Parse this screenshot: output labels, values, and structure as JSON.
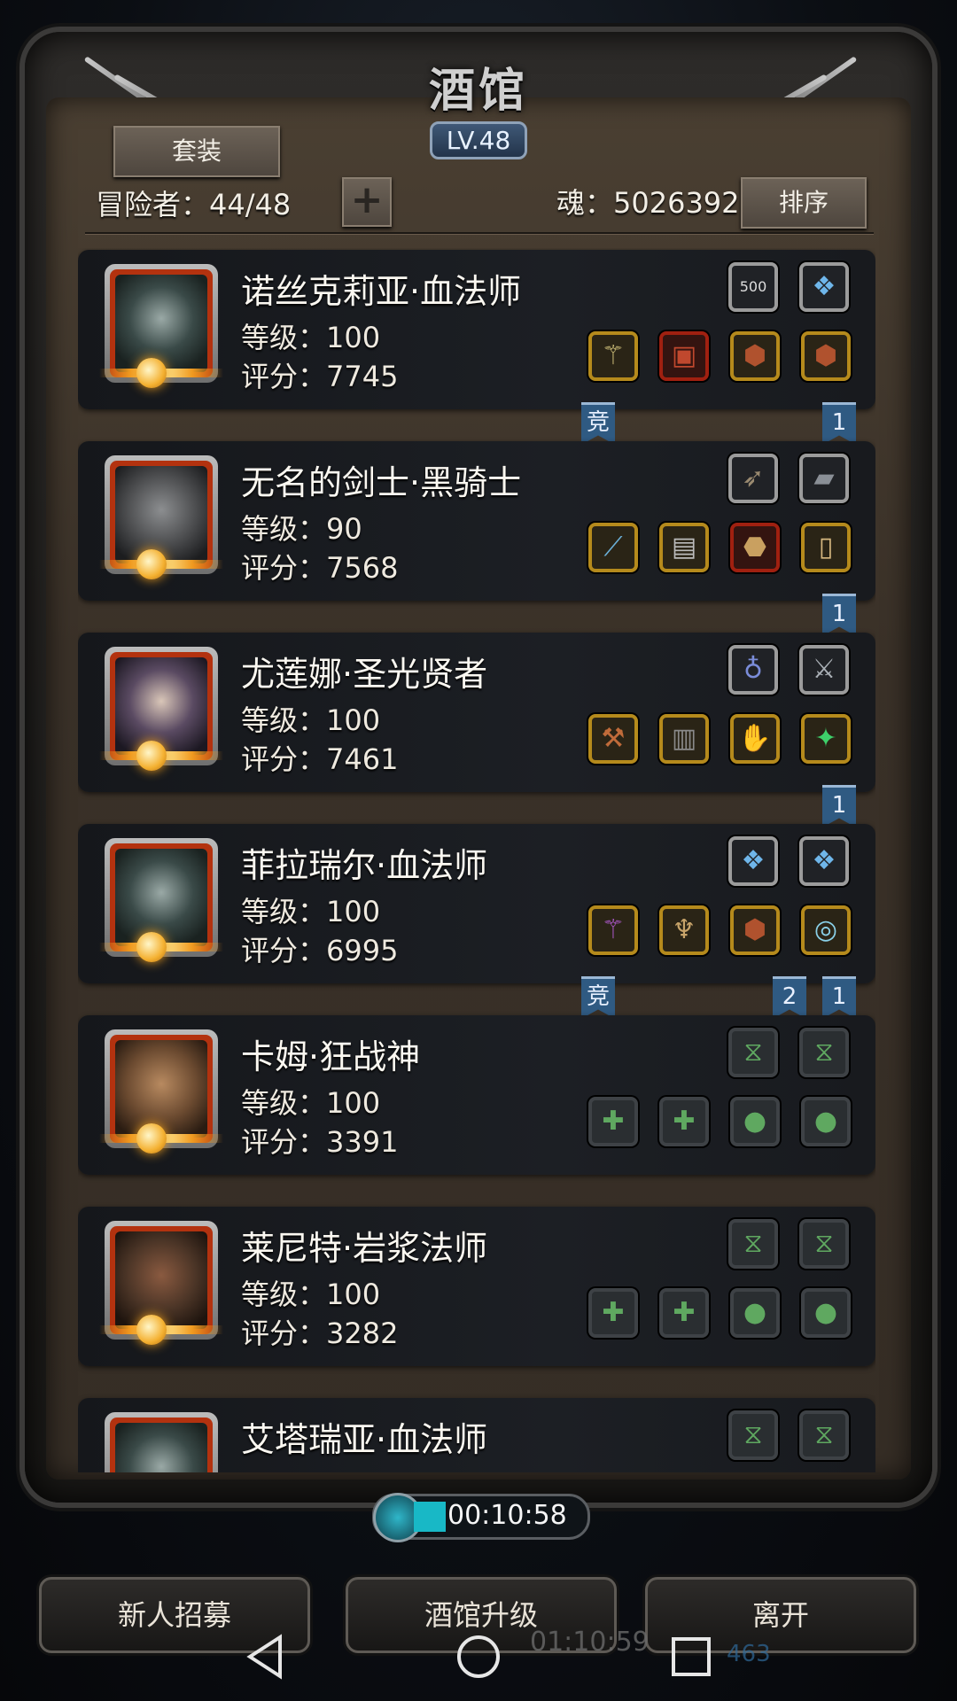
{
  "header": {
    "title": "酒馆",
    "level": "LV.48",
    "suit_button": "套装",
    "adventurers": "冒险者：44/48",
    "soul": "魂：5026392",
    "sort_button": "排序"
  },
  "heroes": [
    {
      "name": "诺丝克莉亚·血法师",
      "level": "等级：100",
      "score": "评分：7745",
      "face": "#33403f"
    },
    {
      "name": "无名的剑士·黑骑士",
      "level": "等级：90",
      "score": "评分：7568",
      "face": "#4a4b4d"
    },
    {
      "name": "尤莲娜·圣光贤者",
      "level": "等级：100",
      "score": "评分：7461",
      "face": "#4d4440"
    },
    {
      "name": "菲拉瑞尔·血法师",
      "level": "等级：100",
      "score": "评分：6995",
      "face": "#33403f"
    },
    {
      "name": "卡姆·狂战神",
      "level": "等级：100",
      "score": "评分：3391",
      "face": "#6b4a30"
    },
    {
      "name": "莱尼特·岩浆法师",
      "level": "等级：100",
      "score": "评分：3282",
      "face": "#4a3426"
    },
    {
      "name": "艾塔瑞亚·血法师",
      "level": "",
      "score": "",
      "face": "#33403f"
    }
  ],
  "slot_text": {
    "badge_500": "500"
  },
  "ribbons": {
    "r1_left": "竞",
    "r1_right": "1",
    "r2_right": "1",
    "r3_right": "1",
    "r4_left": "竞",
    "r4_mid": "2",
    "r4_right": "1"
  },
  "timer": "00:10:58",
  "bottom_buttons": {
    "recruit": "新人招募",
    "upgrade": "酒馆升级",
    "leave": "离开"
  },
  "background": {
    "time": "01:10:59",
    "count": "463"
  },
  "icons": [
    "back-triangle-icon",
    "home-circle-icon",
    "recent-square-icon",
    "clock-icon",
    "plus-icon"
  ]
}
